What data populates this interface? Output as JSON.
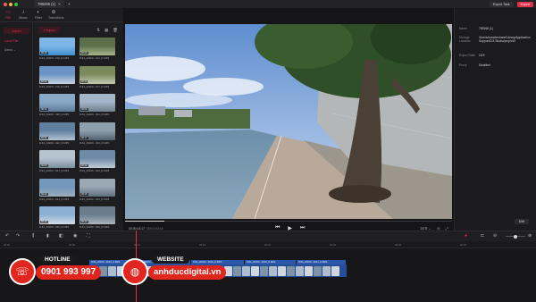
{
  "window": {
    "tab_title": "789268 (1)",
    "export_task": "Export Task",
    "export": "Export"
  },
  "toolbar": {
    "tools": [
      {
        "label": "File",
        "icon": "file-icon"
      },
      {
        "label": "Music",
        "icon": "music-icon"
      },
      {
        "label": "Filter",
        "icon": "filter-icon"
      },
      {
        "label": "Transitions",
        "icon": "transition-icon"
      }
    ],
    "player_label": "Player",
    "info_label": "Project Information"
  },
  "sidebar": {
    "import_label": "Import",
    "local_file": "Local File",
    "demo": "Demo"
  },
  "media": {
    "import_label": "+ Import",
    "items": [
      {
        "name": "DJI4_20200...010_D.MP4",
        "dur": "00:25"
      },
      {
        "name": "DJI4_20200...012_D.MP4",
        "dur": "00:19"
      },
      {
        "name": "DJI4_20200...016_D.MP4",
        "dur": "00:22"
      },
      {
        "name": "DJI4_20200...017_D.MP4",
        "dur": "00:11"
      },
      {
        "name": "DJI4_20200...018_D.MP4",
        "dur": "00:14"
      },
      {
        "name": "DJI4_20200...021_D.MP4",
        "dur": "00:09"
      },
      {
        "name": "DJI4_20200...022_D.MP4",
        "dur": "00:31"
      },
      {
        "name": "DJI4_20200...026_D.MP4",
        "dur": "00:17"
      },
      {
        "name": "DJI4_20200...027_D.MP4",
        "dur": "00:08"
      },
      {
        "name": "DJI4_20200...030_D.MP4",
        "dur": "00:12"
      },
      {
        "name": "DJI4_20200...031_D.MP4",
        "dur": "00:20"
      },
      {
        "name": "DJI4_20200...033_D.MP4",
        "dur": "00:15"
      },
      {
        "name": "DJI4_20200...035_D.MP4",
        "dur": "00:10"
      },
      {
        "name": "DJI4_20200...036_D.MP4",
        "dur": "00:13"
      }
    ]
  },
  "player": {
    "timecode": "00:00:13:17",
    "total": "/ 00:01:02:15",
    "ratio": "16:9",
    "progress_fraction": 0.12
  },
  "info": {
    "rows": [
      {
        "k": "Name",
        "v": "789268 (1)"
      },
      {
        "k": "Storage Location",
        "v": "/Users/wondershare/Library/Application Support/DJI Studio/project/2"
      },
      {
        "k": "Export Ratio",
        "v": "16:9"
      },
      {
        "k": "Proxy",
        "v": "Disabled"
      }
    ],
    "edit": "Edit"
  },
  "timeline": {
    "ruler": [
      "00:00",
      "00:05",
      "00:10",
      "00:15",
      "00:20",
      "00:25",
      "00:30",
      "00:35"
    ],
    "clip_labels": [
      "DJI4_20200...0010_D.MP4",
      "DJI4_20200...0012_D.MP4",
      "DJI4_20200...0016_D.MP4",
      "DJI4_20200...0018_D.MP4",
      "DJI4_20200...0021_D.MP4"
    ]
  },
  "promo": {
    "hotline_label": "HOTLINE",
    "hotline_number": "0901 993 997",
    "website_label": "WEBSITE",
    "website_url": "anhducdigital.vn"
  },
  "colors": {
    "accent": "#e0314a",
    "clip_blue": "#2b58a8",
    "promo_red": "#e0261f"
  }
}
